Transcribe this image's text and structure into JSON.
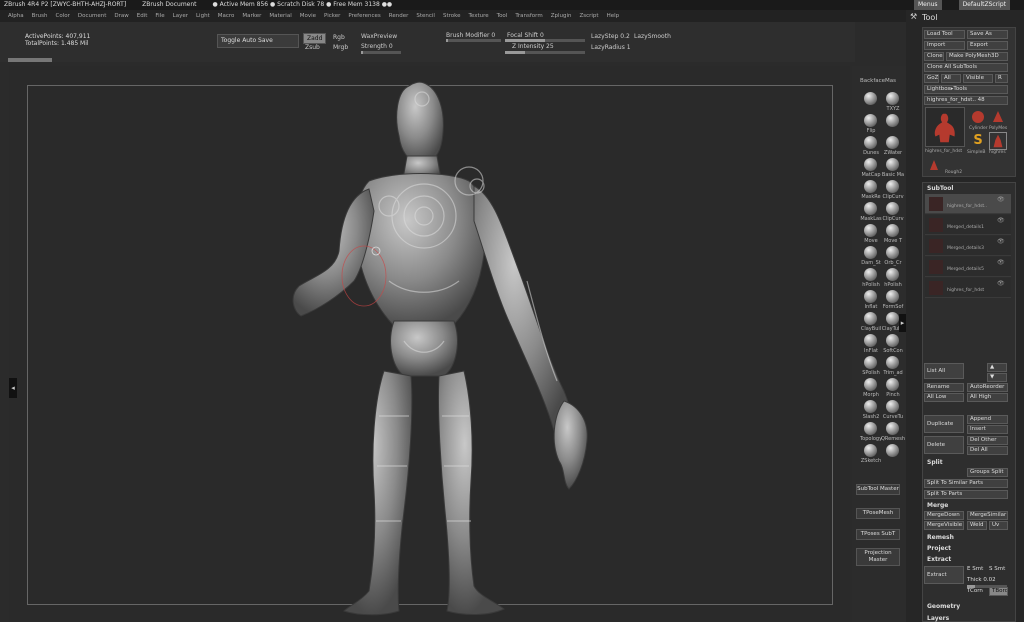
{
  "titlebar": {
    "app": "ZBrush 4R4 P2 [ZWYC-BHTH-AHZJ-RORT]",
    "doc": "ZBrush Document",
    "mem": "● Active Mem 856 ● Scratch Disk 78 ● Free Mem 3138 ●●",
    "menus_btn": "Menus",
    "script_btn": "DefaultZScript"
  },
  "menubar": [
    "Alpha",
    "Brush",
    "Color",
    "Document",
    "Draw",
    "Edit",
    "File",
    "Layer",
    "Light",
    "Macro",
    "Marker",
    "Material",
    "Movie",
    "Picker",
    "Preferences",
    "Render",
    "Stencil",
    "Stroke",
    "Texture",
    "Tool",
    "Transform",
    "Zplugin",
    "Zscript",
    "Help"
  ],
  "topshelf": {
    "active_points": "ActivePoints: 407,911",
    "total_points": "TotalPoints: 1.485 Mil",
    "toggle_autosave": "Toggle Auto Save",
    "zadd": "Zadd",
    "zsub": "Zsub",
    "rgb": "Rgb",
    "mrgb": "Mrgb",
    "waxpreview": "WaxPreview",
    "strength": "Strength 0",
    "brush_modifier": "Brush Modifier 0",
    "focal_shift": "Focal Shift 0",
    "z_intensity": "Z Intensity 25",
    "lazystep": "LazyStep 0.2",
    "lazysmooth": "LazySmooth",
    "lazyradius": "LazyRadius 1"
  },
  "rshelf": {
    "backface": "BackfaceMas",
    "items": [
      "",
      "TXYZ",
      "Flip",
      "",
      "Dunes",
      "ZWater",
      "MatCap",
      "Basic Ma",
      "MaskRe",
      "ClipCurv",
      "MaskLas",
      "ClipCurv",
      "Move",
      "Move T",
      "Dam_St",
      "Orb_Cr",
      "hPolish",
      "hPolish",
      "Inflat",
      "FormSof",
      "ClayBuil",
      "ClayTube",
      "InFlat",
      "SoftCon",
      "SPolish",
      "Trim_ad",
      "Morph",
      "Pinch",
      "Slash2",
      "CurveTu",
      "Topology",
      "QRemesh",
      "ZSketch",
      ""
    ],
    "subtool_master": "SubTool Master",
    "tposemesh": "TPoseMesh",
    "tposes_subt": "TPoses SubT",
    "projection_master": "Projection Master"
  },
  "tray": {
    "title": "Tool",
    "load_tool": "Load Tool",
    "save_as": "Save As",
    "import": "Import",
    "export": "Export",
    "clone": "Clone",
    "make_polymesh": "Make PolyMesh3D",
    "clone_all": "Clone All SubTools",
    "goz": "GoZ",
    "all": "All",
    "visible": "Visible",
    "r": "R",
    "lightbox_tools": "Lightbox▸Tools",
    "tool_name": "highres_for_hdst.. 48",
    "thumbs": [
      "highres_for_hdst",
      "Cylinder",
      "PolyMes",
      "SimpleB",
      "highres",
      "Rough2"
    ],
    "subtool_header": "SubTool",
    "subtools": [
      "highres_for_hdst..",
      "Merged_details1",
      "Merged_details3",
      "Merged_details5",
      "highres_for_hdst"
    ],
    "list_all": "List All",
    "rename": "Rename",
    "autoreorder": "AutoReorder",
    "all_low": "All Low",
    "all_high": "All High",
    "duplicate": "Duplicate",
    "append": "Append",
    "insert": "Insert",
    "delete": "Delete",
    "del_other": "Del Other",
    "del_all": "Del All",
    "split": "Split",
    "groups_split": "Groups Split",
    "split_similar": "Split To Similar Parts",
    "split_parts": "Split To Parts",
    "merge": "Merge",
    "mergedown": "MergeDown",
    "mergesimilar": "MergeSimilar",
    "mergevisible": "MergeVisible",
    "weld": "Weld",
    "uv": "Uv",
    "remesh": "Remesh",
    "project": "Project",
    "extract_head": "Extract",
    "extract_btn": "Extract",
    "e_smt": "E Smt",
    "s_smt": "S Smt",
    "thick": "Thick 0.02",
    "tcorn": "TCorn",
    "tborder": "TBorder",
    "geometry": "Geometry",
    "layers": "Layers"
  }
}
